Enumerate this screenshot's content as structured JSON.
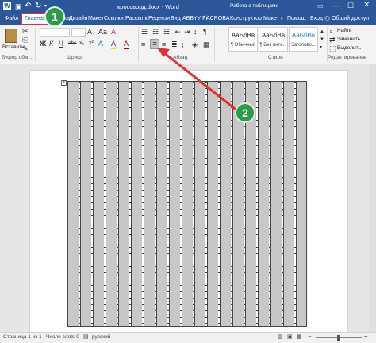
{
  "title": {
    "text": "кроссворд.docx - Word",
    "table_tools": "Работа с таблицами",
    "undo_icon": "undo-icon",
    "redo_icon": "redo-icon",
    "save_icon": "save-icon"
  },
  "tabs": [
    {
      "label": "Файл"
    },
    {
      "label": "Главная"
    },
    {
      "label": "Вставка"
    },
    {
      "label": "Дизайн"
    },
    {
      "label": "Макет"
    },
    {
      "label": "Ссылки"
    },
    {
      "label": "Рассылк"
    },
    {
      "label": "Рецензи"
    },
    {
      "label": "Вид"
    },
    {
      "label": "ABBYY Fi"
    },
    {
      "label": "ACROBA"
    },
    {
      "label": "Конструктор"
    },
    {
      "label": "Макет"
    },
    {
      "label": "Помощ"
    },
    {
      "label": "Вход"
    },
    {
      "label": "Общий доступ"
    }
  ],
  "ribbon": {
    "paste_label": "Вставить",
    "clipboard_label": "Буфер обм...",
    "font_label": "Шрифт",
    "paragraph_label": "Абзац",
    "styles_label": "Стили",
    "editing_label": "Редактирование",
    "font_bold": "Ж",
    "font_italic": "К",
    "font_underline": "Ч",
    "font_strike": "abc",
    "font_sub": "x₂",
    "font_sup": "x²",
    "highlight_icon": "A",
    "color_icon": "A",
    "styles": [
      {
        "sample": "АаБбВв",
        "name": "¶ Обычный"
      },
      {
        "sample": "АаБбВв",
        "name": "¶ Без инте..."
      },
      {
        "sample": "АаБбВв",
        "name": "Заголово..."
      }
    ],
    "find_label": "Найти",
    "replace_label": "Заменить",
    "select_label": "Выделить"
  },
  "callouts": [
    "1",
    "2"
  ],
  "status": {
    "page": "Страница 1 из 1",
    "words": "Число слов: 0",
    "language": "русский"
  },
  "colors": {
    "title_bg": "#2b579a",
    "active_tab_bg": "#ffffff",
    "callout_green": "#2e9a4a",
    "arrow_red": "#e03030",
    "cell_shade": "#c8c8c8"
  }
}
